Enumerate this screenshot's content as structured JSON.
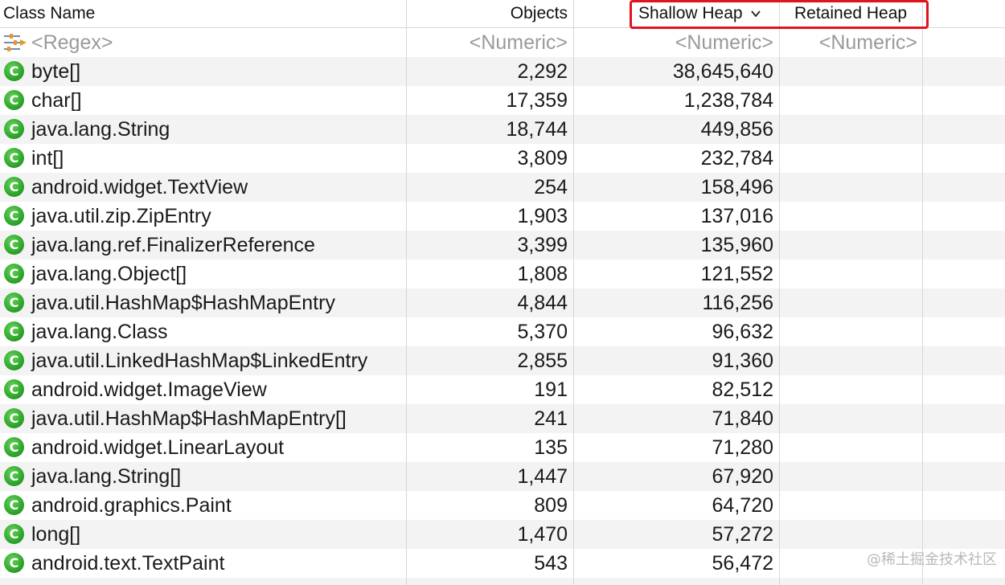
{
  "header": {
    "class_name": "Class Name",
    "objects": "Objects",
    "shallow_heap": "Shallow Heap",
    "retained_heap": "Retained Heap",
    "sort_indicator_icon": "chevron-down-icon"
  },
  "filter": {
    "class_name": "<Regex>",
    "objects": "<Numeric>",
    "shallow_heap": "<Numeric>",
    "retained_heap": "<Numeric>",
    "icon": "filter-regex-icon"
  },
  "rows": [
    {
      "name": "byte[]",
      "objects": "2,292",
      "shallow": "38,645,640",
      "retained": ""
    },
    {
      "name": "char[]",
      "objects": "17,359",
      "shallow": "1,238,784",
      "retained": ""
    },
    {
      "name": "java.lang.String",
      "objects": "18,744",
      "shallow": "449,856",
      "retained": ""
    },
    {
      "name": "int[]",
      "objects": "3,809",
      "shallow": "232,784",
      "retained": ""
    },
    {
      "name": "android.widget.TextView",
      "objects": "254",
      "shallow": "158,496",
      "retained": ""
    },
    {
      "name": "java.util.zip.ZipEntry",
      "objects": "1,903",
      "shallow": "137,016",
      "retained": ""
    },
    {
      "name": "java.lang.ref.FinalizerReference",
      "objects": "3,399",
      "shallow": "135,960",
      "retained": ""
    },
    {
      "name": "java.lang.Object[]",
      "objects": "1,808",
      "shallow": "121,552",
      "retained": ""
    },
    {
      "name": "java.util.HashMap$HashMapEntry",
      "objects": "4,844",
      "shallow": "116,256",
      "retained": ""
    },
    {
      "name": "java.lang.Class",
      "objects": "5,370",
      "shallow": "96,632",
      "retained": ""
    },
    {
      "name": "java.util.LinkedHashMap$LinkedEntry",
      "objects": "2,855",
      "shallow": "91,360",
      "retained": ""
    },
    {
      "name": "android.widget.ImageView",
      "objects": "191",
      "shallow": "82,512",
      "retained": ""
    },
    {
      "name": "java.util.HashMap$HashMapEntry[]",
      "objects": "241",
      "shallow": "71,840",
      "retained": ""
    },
    {
      "name": "android.widget.LinearLayout",
      "objects": "135",
      "shallow": "71,280",
      "retained": ""
    },
    {
      "name": "java.lang.String[]",
      "objects": "1,447",
      "shallow": "67,920",
      "retained": ""
    },
    {
      "name": "android.graphics.Paint",
      "objects": "809",
      "shallow": "64,720",
      "retained": ""
    },
    {
      "name": "long[]",
      "objects": "1,470",
      "shallow": "57,272",
      "retained": ""
    },
    {
      "name": "android.text.TextPaint",
      "objects": "543",
      "shallow": "56,472",
      "retained": ""
    }
  ],
  "row_icon": {
    "glyph": "C",
    "name": "class-icon",
    "color": "#2ea62a"
  },
  "highlight_color": "#e0141e",
  "watermark": "@稀土掘金技术社区"
}
